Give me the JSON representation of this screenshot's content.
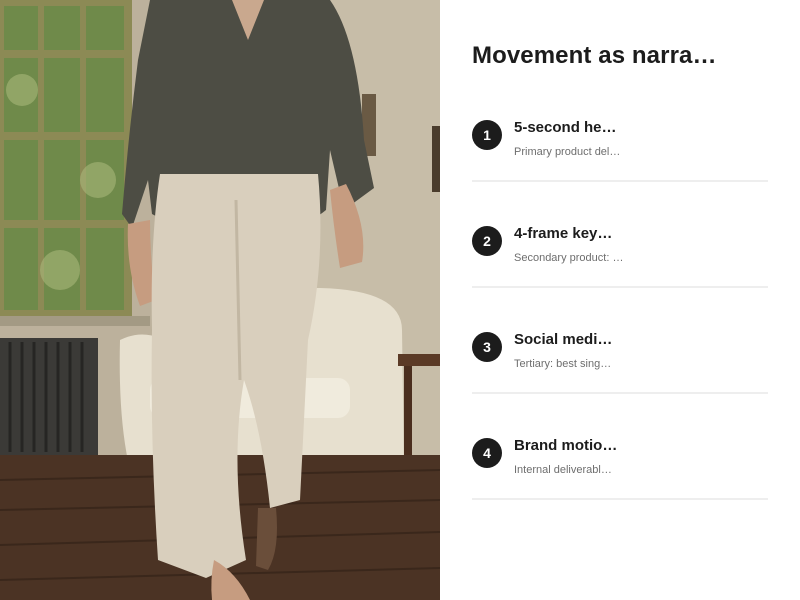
{
  "panel": {
    "title": "Movement as narra…"
  },
  "steps": [
    {
      "number": "1",
      "title": "5-second he…",
      "subtitle": "Primary product del…"
    },
    {
      "number": "2",
      "title": "4-frame key…",
      "subtitle": "Secondary product: …"
    },
    {
      "number": "3",
      "title": "Social medi…",
      "subtitle": "Tertiary: best sing…"
    },
    {
      "number": "4",
      "title": "Brand motio…",
      "subtitle": "Internal deliverabl…"
    }
  ],
  "colors": {
    "step_badge": "#1c1c1c",
    "divider": "#eeeeee",
    "subtitle": "#6e6e6e"
  }
}
